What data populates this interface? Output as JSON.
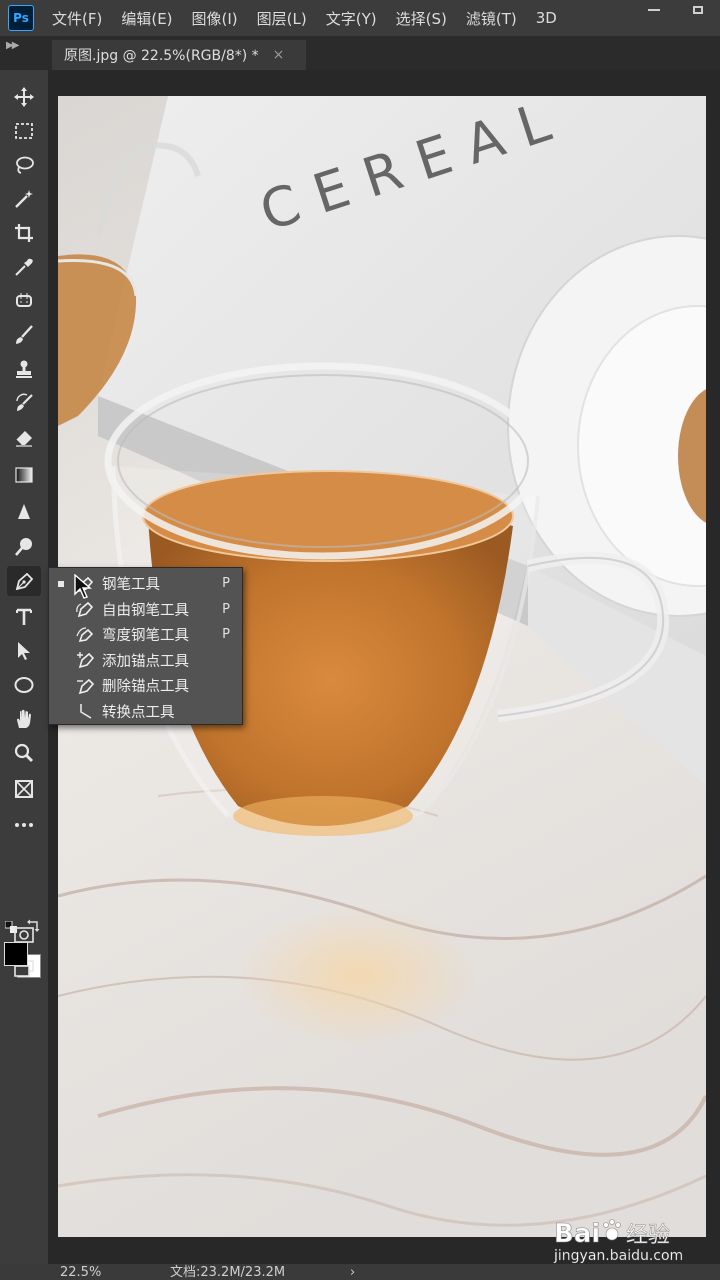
{
  "app": {
    "logo_text": "Ps"
  },
  "menu": [
    "文件(F)",
    "编辑(E)",
    "图像(I)",
    "图层(L)",
    "文字(Y)",
    "选择(S)",
    "滤镜(T)",
    "3D"
  ],
  "tab": {
    "title": "原图.jpg @ 22.5%(RGB/8*) *",
    "close": "×"
  },
  "flyout": {
    "items": [
      {
        "label": "钢笔工具",
        "key": "P",
        "icon": "pen-icon",
        "active": true
      },
      {
        "label": "自由钢笔工具",
        "key": "P",
        "icon": "freeform-pen-icon",
        "active": false
      },
      {
        "label": "弯度钢笔工具",
        "key": "P",
        "icon": "curvature-pen-icon",
        "active": false
      },
      {
        "label": "添加锚点工具",
        "key": "",
        "icon": "add-anchor-icon",
        "active": false
      },
      {
        "label": "删除锚点工具",
        "key": "",
        "icon": "delete-anchor-icon",
        "active": false
      },
      {
        "label": "转换点工具",
        "key": "",
        "icon": "convert-point-icon",
        "active": false
      }
    ]
  },
  "canvas": {
    "book_text": "CEREAL"
  },
  "status": {
    "zoom": "22.5%",
    "doc": "文档:23.2M/23.2M",
    "arrow": "›"
  },
  "watermark": {
    "brand": "Bai",
    "brand_tail": "经验",
    "url": "jingyan.baidu.com"
  },
  "colors": {
    "foreground": "#000000",
    "background": "#ffffff",
    "panel": "#3c3c3c",
    "accent": "#31a8ff"
  }
}
